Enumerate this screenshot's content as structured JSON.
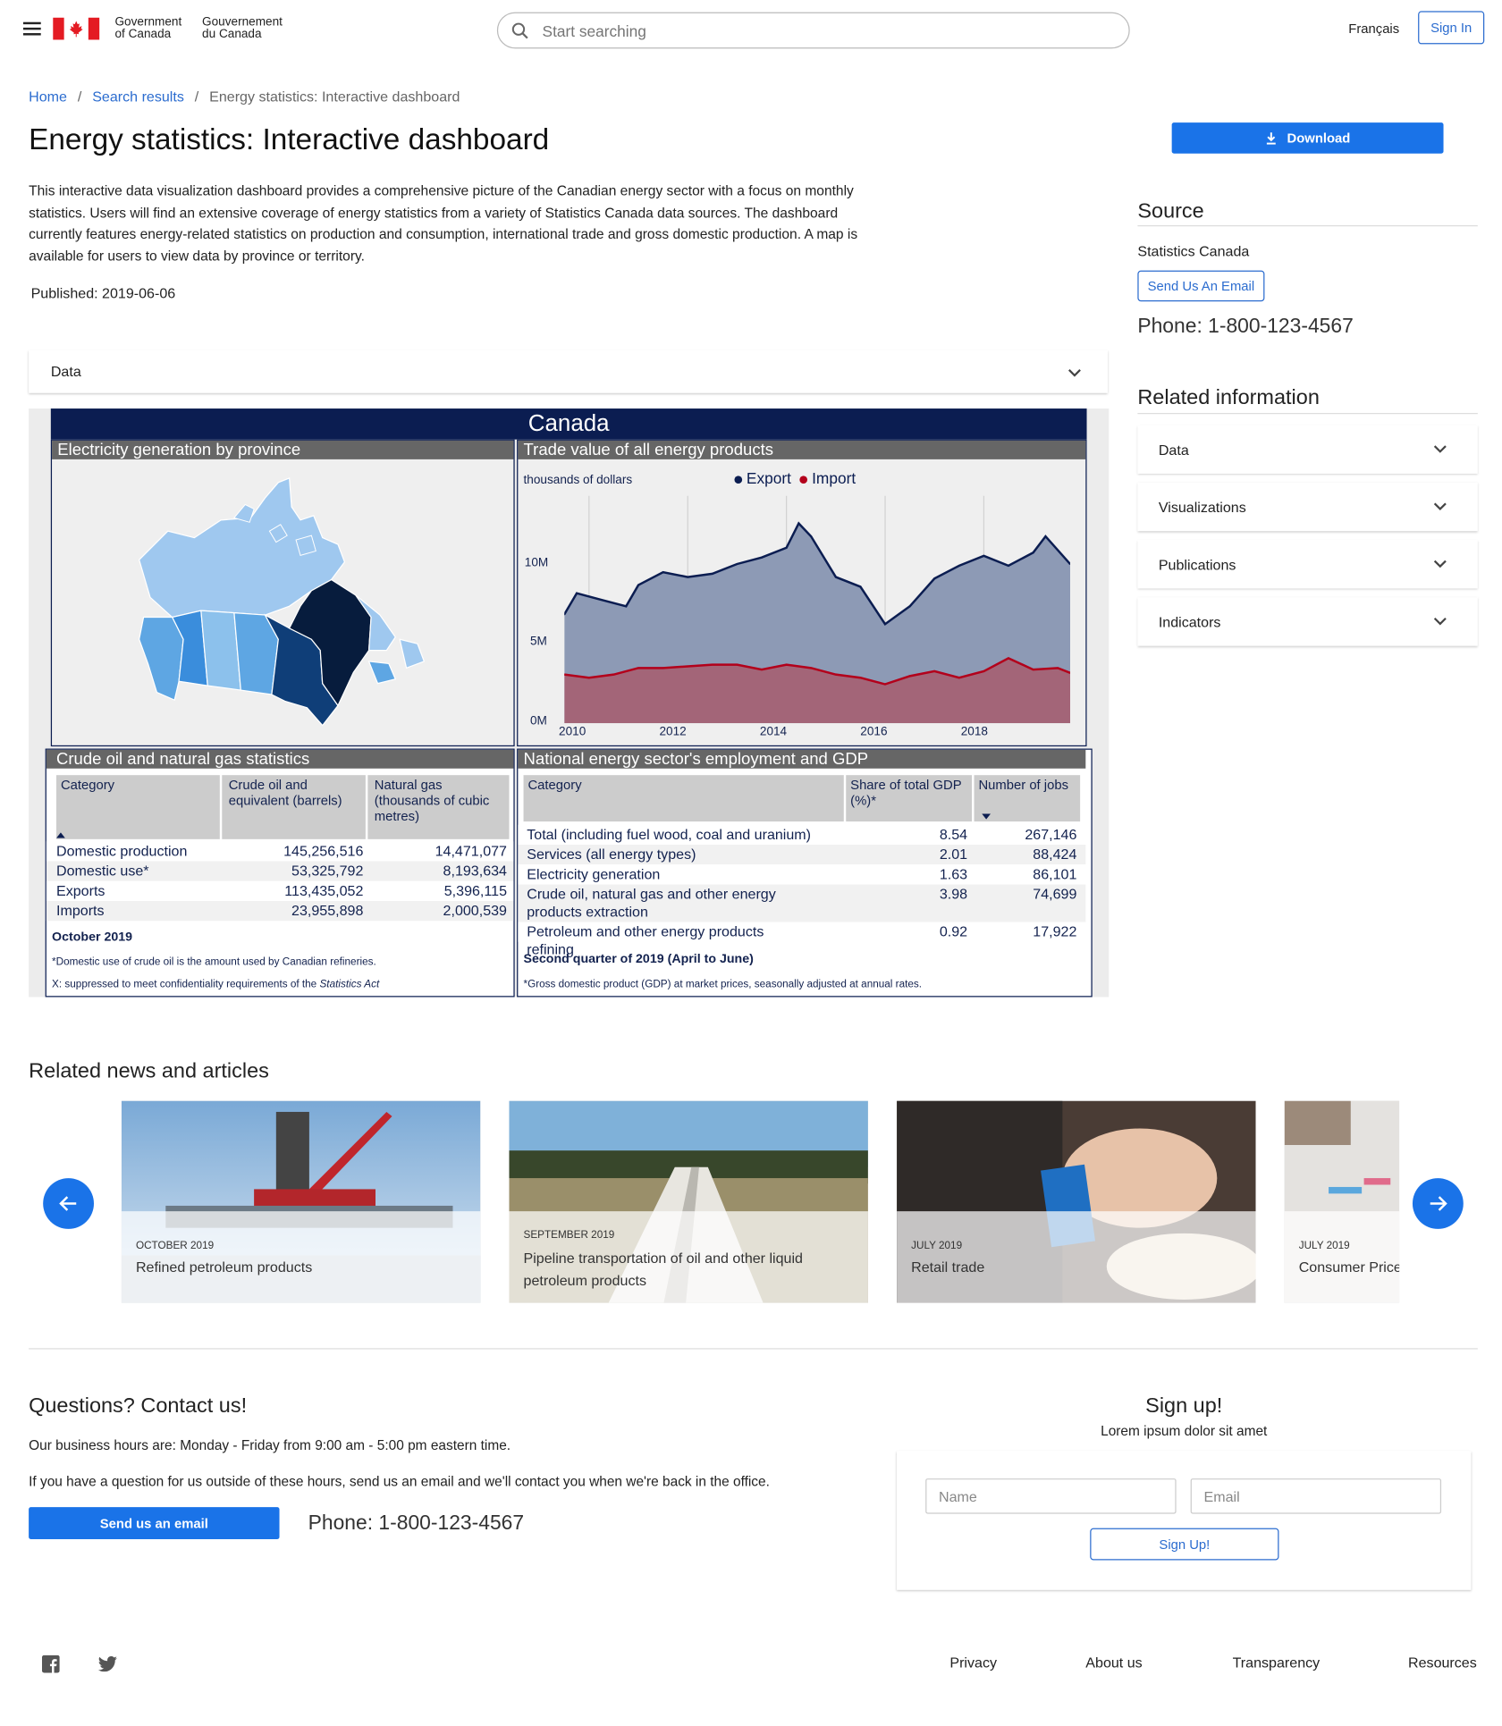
{
  "header": {
    "gov_en_line1": "Government",
    "gov_en_line2": "of Canada",
    "gov_fr_line1": "Gouvernement",
    "gov_fr_line2": "du Canada",
    "search_placeholder": "Start searching",
    "lang_link": "Français",
    "sign_in": "Sign In"
  },
  "breadcrumb": {
    "items": [
      "Home",
      "Search results",
      "Energy statistics: Interactive dashboard"
    ]
  },
  "page": {
    "title": "Energy statistics: Interactive dashboard",
    "description": "This interactive data visualization dashboard provides a comprehensive picture of the Canadian energy sector with a focus on monthly statistics. Users will find an extensive coverage of energy statistics from a variety of Statistics Canada data sources. The dashboard currently features energy-related statistics on production and consumption, international trade and gross domestic production. A map is available for users to view data by province or territory.",
    "published": "Published: 2019-06-06",
    "data_accordion": "Data"
  },
  "sidebar": {
    "download": "Download",
    "source_heading": "Source",
    "source_name": "Statistics Canada",
    "email_button": "Send Us An Email",
    "phone": "Phone: 1-800-123-4567",
    "related_heading": "Related information",
    "related_items": [
      "Data",
      "Visualizations",
      "Publications",
      "Indicators"
    ]
  },
  "dashboard": {
    "title": "Canada",
    "map_heading": "Electricity generation by province",
    "trade_heading": "Trade value of all energy products",
    "trade_unit": "thousands of dollars",
    "legend_export": "Export",
    "legend_import": "Import",
    "y_ticks": [
      "10M",
      "5M",
      "0M"
    ],
    "x_ticks": [
      "2010",
      "2012",
      "2014",
      "2016",
      "2018"
    ],
    "oil_heading": "Crude oil and natural gas statistics",
    "oil_cols": [
      "Category",
      "Crude oil and equivalent (barrels)",
      "Natural gas (thousands of cubic metres)"
    ],
    "oil_rows": [
      [
        "Domestic production",
        "145,256,516",
        "14,471,077"
      ],
      [
        "Domestic use*",
        "53,325,792",
        "8,193,634"
      ],
      [
        "Exports",
        "113,435,052",
        "5,396,115"
      ],
      [
        "Imports",
        "23,955,898",
        "2,000,539"
      ]
    ],
    "oil_date": "October 2019",
    "oil_note1": "*Domestic use of crude oil is the amount used by Canadian refineries.",
    "oil_note2_pre": "X: suppressed to meet confidentiality requirements of the ",
    "oil_note2_em": "Statistics Act",
    "emp_heading": "National energy sector's employment and GDP",
    "emp_cols": [
      "Category",
      "Share of total GDP (%)*",
      "Number of jobs"
    ],
    "emp_rows": [
      [
        "Total (including fuel wood, coal and uranium)",
        "8.54",
        "267,146"
      ],
      [
        "Services (all energy types)",
        "2.01",
        "88,424"
      ],
      [
        "Electricity generation",
        "1.63",
        "86,101"
      ],
      [
        "Crude oil, natural gas and other energy products extraction",
        "3.98",
        "74,699"
      ],
      [
        "Petroleum and other energy products refining",
        "0.92",
        "17,922"
      ]
    ],
    "emp_date": "Second quarter of 2019 (April to June)",
    "emp_note": "*Gross domestic product (GDP) at market prices, seasonally adjusted at annual rates."
  },
  "chart_data": {
    "type": "area",
    "title": "Trade value of all energy products",
    "ylabel": "thousands of dollars",
    "x_range": [
      "2009-07",
      "2019-10"
    ],
    "ylim": [
      0,
      14000000
    ],
    "series": [
      {
        "name": "Export",
        "color": "#0b1d51",
        "fill": "#8d9ab5",
        "points": [
          [
            "2009-07",
            6700000
          ],
          [
            "2009-10",
            8000000
          ],
          [
            "2010-04",
            7600000
          ],
          [
            "2010-10",
            7200000
          ],
          [
            "2011-01",
            8500000
          ],
          [
            "2011-07",
            9300000
          ],
          [
            "2012-01",
            9000000
          ],
          [
            "2012-07",
            9200000
          ],
          [
            "2013-01",
            9800000
          ],
          [
            "2013-07",
            10200000
          ],
          [
            "2014-01",
            10800000
          ],
          [
            "2014-04",
            12300000
          ],
          [
            "2014-07",
            11500000
          ],
          [
            "2015-01",
            9000000
          ],
          [
            "2015-07",
            8400000
          ],
          [
            "2016-01",
            6100000
          ],
          [
            "2016-07",
            7200000
          ],
          [
            "2017-01",
            8900000
          ],
          [
            "2017-07",
            9700000
          ],
          [
            "2018-01",
            10300000
          ],
          [
            "2018-07",
            9700000
          ],
          [
            "2019-01",
            10500000
          ],
          [
            "2019-04",
            11500000
          ],
          [
            "2019-10",
            9800000
          ]
        ]
      },
      {
        "name": "Import",
        "color": "#b3001b",
        "fill": "#a36578",
        "points": [
          [
            "2009-07",
            3000000
          ],
          [
            "2010-01",
            2800000
          ],
          [
            "2010-07",
            3000000
          ],
          [
            "2011-01",
            3400000
          ],
          [
            "2011-07",
            3400000
          ],
          [
            "2012-01",
            3500000
          ],
          [
            "2012-07",
            3600000
          ],
          [
            "2013-01",
            3600000
          ],
          [
            "2013-07",
            3300000
          ],
          [
            "2014-01",
            3600000
          ],
          [
            "2014-07",
            3400000
          ],
          [
            "2015-01",
            3000000
          ],
          [
            "2015-07",
            2800000
          ],
          [
            "2016-01",
            2400000
          ],
          [
            "2016-07",
            2900000
          ],
          [
            "2017-01",
            3200000
          ],
          [
            "2017-07",
            2800000
          ],
          [
            "2018-01",
            3200000
          ],
          [
            "2018-07",
            4000000
          ],
          [
            "2019-01",
            3300000
          ],
          [
            "2019-07",
            3400000
          ],
          [
            "2019-10",
            3100000
          ]
        ]
      }
    ]
  },
  "news": {
    "heading": "Related news and articles",
    "items": [
      {
        "date": "OCTOBER 2019",
        "title": "Refined petroleum products"
      },
      {
        "date": "SEPTEMBER 2019",
        "title": "Pipeline transportation of oil and other liquid petroleum products"
      },
      {
        "date": "JULY 2019",
        "title": "Retail trade"
      },
      {
        "date": "JULY 2019",
        "title": "Consumer Price"
      }
    ]
  },
  "contact": {
    "heading": "Questions? Contact us!",
    "hours": "Our business hours are: Monday - Friday from 9:00 am - 5:00 pm eastern time.",
    "outside": "If you have a question for us outside of these hours, send us an email and we'll contact you when we're back in the office.",
    "email_button": "Send us an email",
    "phone": "Phone: 1-800-123-4567"
  },
  "signup": {
    "heading": "Sign up!",
    "subtitle": "Lorem ipsum dolor sit amet",
    "name_placeholder": "Name",
    "email_placeholder": "Email",
    "button": "Sign Up!"
  },
  "footer": {
    "links": [
      "Privacy",
      "About us",
      "Transparency",
      "Resources"
    ]
  }
}
